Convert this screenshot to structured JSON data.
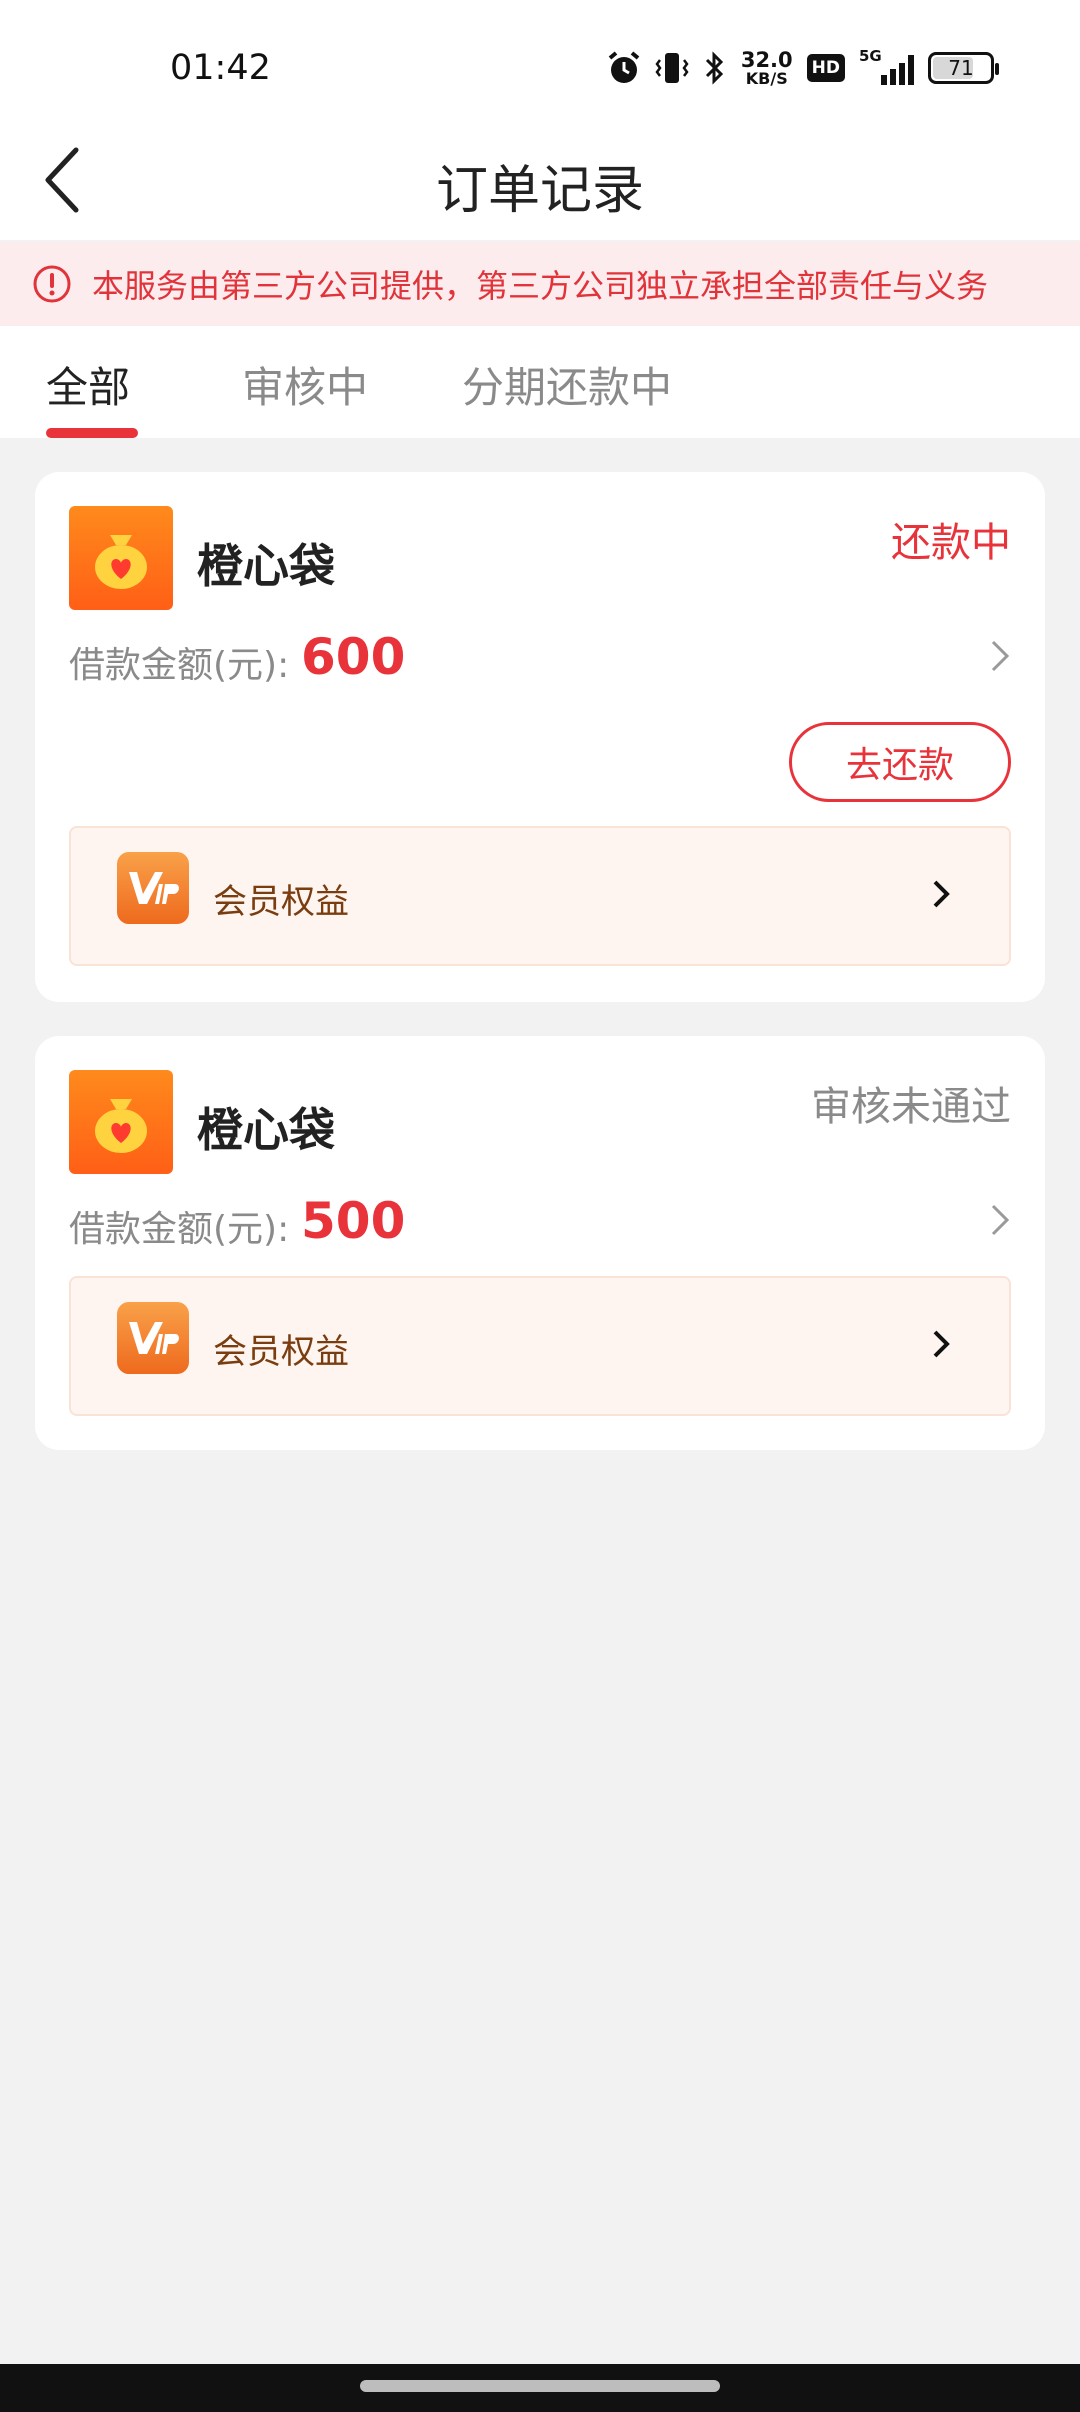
{
  "status_bar": {
    "time": "01:42",
    "net_speed_value": "32.0",
    "net_speed_unit": "KB/S",
    "hd_label": "HD",
    "signal_label": "5G",
    "battery": "71",
    "battery_fraction": 0.71
  },
  "header": {
    "title": "订单记录"
  },
  "notice": {
    "text": "本服务由第三方公司提供，第三方公司独立承担全部责任与义务"
  },
  "tabs": [
    {
      "label": "全部",
      "active": true
    },
    {
      "label": "审核中",
      "active": false
    },
    {
      "label": "分期还款中",
      "active": false
    }
  ],
  "orders": [
    {
      "app_name": "橙心袋",
      "status": "还款中",
      "status_color": "#e8333b",
      "amount_label": "借款金额(元):",
      "amount": "600",
      "action_label": "去还款",
      "vip_label": "会员权益"
    },
    {
      "app_name": "橙心袋",
      "status": "审核未通过",
      "status_color": "#8a8a8a",
      "amount_label": "借款金额(元):",
      "amount": "500",
      "vip_label": "会员权益"
    }
  ],
  "colors": {
    "accent": "#e8333b",
    "brand_orange": "#ff6a16",
    "background": "#f2f2f2"
  }
}
